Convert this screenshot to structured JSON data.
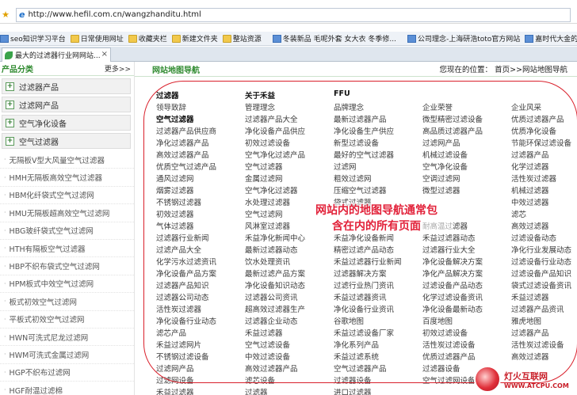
{
  "browser": {
    "url": "http://www.hefil.com.cn/wangzhanditu.html",
    "tab_title": "最大的过滤器行业网网站...",
    "tab_close": "×",
    "favorites": [
      "seo知识学习平台",
      "日常使用网址",
      "收藏夹栏",
      "新建文件夹",
      "整站资源",
      "冬装新品 毛呢外套 女大衣 冬季修...",
      "公司理念-上海研浩toto官方网站",
      "嘉时代大金的"
    ]
  },
  "sidebar": {
    "title": "产品分类",
    "more": "更多>>",
    "categories": [
      "过滤器产品",
      "过滤网产品",
      "空气净化设备",
      "空气过滤器"
    ],
    "items": [
      "无隔板V型大风量空气过滤器",
      "HMH无隔板高效空气过滤器",
      "HBM化纤袋式空气过滤网",
      "HMU无隔板超高效空气过滤网",
      "HBG玻纤袋式空气过滤网",
      "HTH有隔板空气过滤器",
      "HBP不织布袋式空气过滤网",
      "HPM板式中效空气过滤网",
      "板式初效空气过滤网",
      "平板式初效空气过滤网",
      "HWN可洗式尼龙过滤网",
      "HWM可洗式金属过滤网",
      "HGP不织布过滤网",
      "HGF耐温过滤棉"
    ]
  },
  "main": {
    "title": "网站地图导航",
    "location": "您现在的位置： 首页>>网站地图导航"
  },
  "sitemap": {
    "rows": [
      [
        "过滤器",
        "关于禾益",
        "FFU",
        "",
        ""
      ],
      [
        "领导致辞",
        "管理理念",
        "品牌理念",
        "企业荣誉",
        "企业风采"
      ],
      [
        "空气过滤器",
        "过滤器产品大全",
        "最新过滤器产品",
        "微型精密过滤设备",
        "优质过滤器产品"
      ],
      [
        "过滤器产品供应商",
        "净化设备产品供应",
        "净化设备生产供应",
        "高品质过滤器产品",
        "优质净化设备"
      ],
      [
        "净化过滤器产品",
        "初效过滤设备",
        "新型过滤设备",
        "过滤网产品",
        "节能环保过滤设备"
      ],
      [
        "高效过滤器产品",
        "空气净化过滤产品",
        "最好的空气过滤器",
        "机械过滤设备",
        "过滤器产品"
      ],
      [
        "优质空气过滤产品",
        "空气过滤器",
        "过滤网",
        "空气净化设备",
        "化学过滤器"
      ],
      [
        "通风过滤网",
        "金属过滤网",
        "粗效过滤网",
        "空调过滤网",
        "活性炭过滤器"
      ],
      [
        "烟雾过滤器",
        "空气净化过滤器",
        "压缩空气过滤器",
        "微型过滤器",
        "机械过滤器"
      ],
      [
        "不锈钢过滤器",
        "水处理过滤器",
        "袋式过滤器",
        "",
        "中效过滤器"
      ],
      [
        "初效过滤器",
        "空气过滤网",
        "",
        "",
        "滤芯"
      ],
      [
        "气体过滤器",
        "风淋室过滤器",
        "",
        "耐高温过滤器",
        "高效过滤器"
      ],
      [
        "过滤器行业新闻",
        "禾益净化新闻中心",
        "禾益净化设备新闻",
        "禾益过滤器动态",
        "过滤设备动态"
      ],
      [
        "过滤产品大全",
        "最新过滤器动态",
        "精密过滤产品动态",
        "过滤器行业大全",
        "净化行业发展动态"
      ],
      [
        "化学污水过滤资讯",
        "饮水处理资讯",
        "禾益过滤器行业新闻",
        "净化设备解决方案",
        "过滤设备行业动态"
      ],
      [
        "净化设备产品方案",
        "最新过滤产品方案",
        "过滤器解决方案",
        "净化产品解决方案",
        "过滤设备产品知识"
      ],
      [
        "过滤器产品知识",
        "净化设备知识动态",
        "过滤行业热门资讯",
        "过滤设备产品动态",
        "袋式过滤设备资讯"
      ],
      [
        "过滤器公司动态",
        "过滤器公司资讯",
        "禾益过滤器资讯",
        "化学过滤设备资讯",
        "禾益过滤器"
      ],
      [
        "活性炭过滤器",
        "超高效过滤器生产",
        "净化设备行业资讯",
        "净化设备最新动态",
        "过滤器产品资讯"
      ],
      [
        "净化设备行业动态",
        "过滤器企业动态",
        "谷歌地图",
        "百度地图",
        "雅虎地图"
      ],
      [
        "滤芯产品",
        "禾益过滤器",
        "禾益过滤设备厂家",
        "初效过滤设备",
        "过滤器产品"
      ],
      [
        "禾益过滤网片",
        "空气过滤设备",
        "净化系列产品",
        "活性炭过滤设备",
        "活性炭过滤设备"
      ],
      [
        "不锈钢过滤设备",
        "中效过滤设备",
        "禾益过滤系统",
        "优质过滤器产品",
        "高效过滤器"
      ],
      [
        "过滤网产品",
        "高效过滤器产品",
        "空气过滤器产品",
        "过滤器设备",
        ""
      ],
      [
        "过滤网设备",
        "滤芯设备",
        "过滤器设备",
        "空气过滤网设备",
        ""
      ],
      [
        "禾益过滤器",
        "过滤器",
        "进口过滤器",
        "",
        ""
      ]
    ]
  },
  "annotation": {
    "line1": "网站内的地图导航通常包",
    "line2": "含在内的所有页面"
  },
  "watermark": {
    "line1": "灯火互联网",
    "line2": "WWW.ATCPU.COM"
  },
  "colors": {
    "accent_green": "#2f8a2f",
    "annotation_red": "#d9202b"
  }
}
